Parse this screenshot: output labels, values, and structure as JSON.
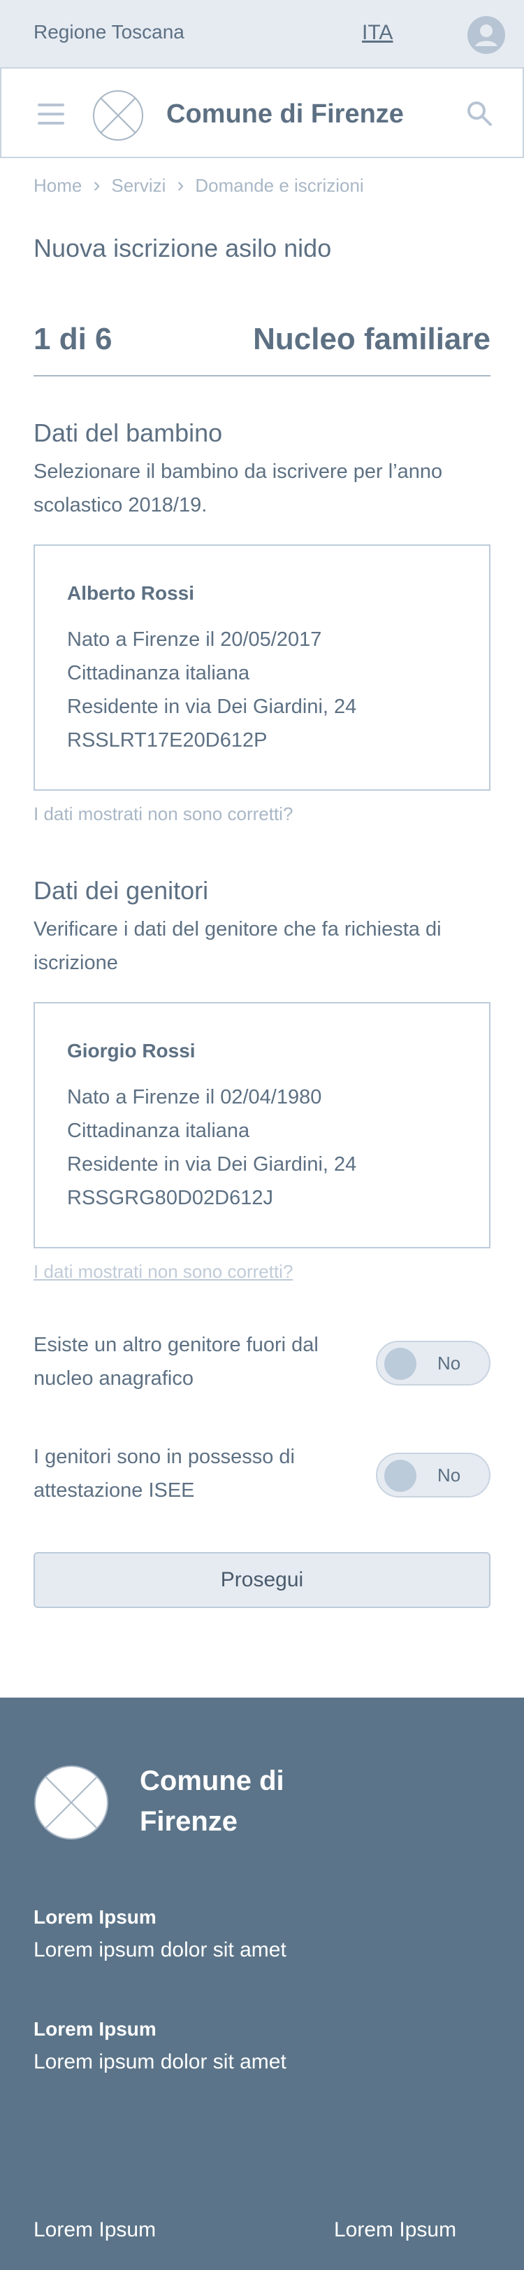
{
  "topbar": {
    "region": "Regione Toscana",
    "language": "ITA"
  },
  "header": {
    "title": "Comune di Firenze"
  },
  "breadcrumb": {
    "items": [
      "Home",
      "Servizi",
      "Domande e iscrizioni"
    ]
  },
  "page": {
    "title": "Nuova iscrizione asilo nido"
  },
  "stepper": {
    "count": "1 di 6",
    "name": "Nucleo familiare"
  },
  "child_section": {
    "title": "Dati del bambino",
    "description": "Selezionare il bambino da iscrivere per l’anno scolastico 2018/19.",
    "card": {
      "name": "Alberto Rossi",
      "lines": [
        "Nato a Firenze il 20/05/2017",
        "Cittadinanza italiana",
        "Residente in via Dei Giardini, 24",
        "RSSLRT17E20D612P"
      ]
    },
    "note": "I dati mostrati non sono corretti?"
  },
  "parent_section": {
    "title": "Dati dei genitori",
    "description": "Verificare i dati del genitore che fa richiesta di iscrizione",
    "card": {
      "name": "Giorgio Rossi",
      "lines": [
        "Nato a Firenze il 02/04/1980",
        "Cittadinanza italiana",
        "Residente in via Dei Giardini, 24",
        "RSSGRG80D02D612J"
      ]
    },
    "note": "I dati mostrati non sono corretti?"
  },
  "toggles": [
    {
      "label": "Esiste un altro genitore fuori dal nucleo anagrafico",
      "value": "No"
    },
    {
      "label": "I genitori sono in possesso di attestazione ISEE",
      "value": "No"
    }
  ],
  "actions": {
    "continue": "Prosegui"
  },
  "footer": {
    "title": "Comune di Firenze",
    "blocks": [
      {
        "title": "Lorem Ipsum",
        "text": "Lorem ipsum dolor sit amet"
      },
      {
        "title": "Lorem Ipsum",
        "text": "Lorem ipsum dolor sit amet"
      }
    ],
    "links": [
      "Lorem Ipsum",
      "Lorem Ipsum"
    ]
  },
  "colors": {
    "primary": "#5d7083",
    "muted": "#a9b7c6",
    "footer_bg": "#5b7489",
    "surface": "#e6ebf2"
  }
}
